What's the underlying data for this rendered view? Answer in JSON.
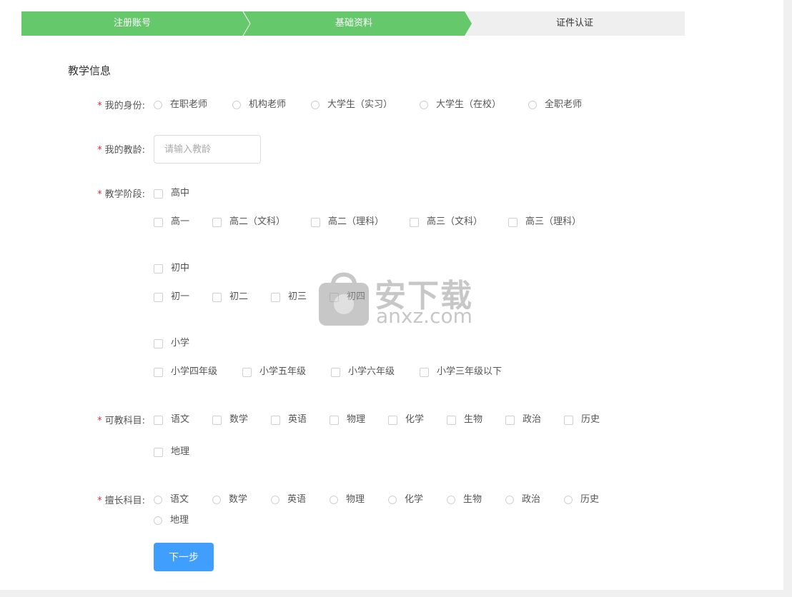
{
  "steps": [
    {
      "label": "注册账号",
      "state": "done"
    },
    {
      "label": "基础资料",
      "state": "done"
    },
    {
      "label": "证件认证",
      "state": "todo"
    }
  ],
  "colors": {
    "step_done": "#65c96b",
    "step_todo": "#efefef",
    "primary": "#409eff",
    "required": "#f5222d"
  },
  "section_title": "教学信息",
  "identity": {
    "label": "我的身份:",
    "options": [
      "在职老师",
      "机构老师",
      "大学生（实习）",
      "大学生（在校）",
      "全职老师"
    ]
  },
  "teaching_age": {
    "label": "我的教龄:",
    "placeholder": "请输入教龄",
    "value": ""
  },
  "stage": {
    "label": "教学阶段:",
    "groups": [
      {
        "name": "高中",
        "grades": [
          "高一",
          "高二（文科）",
          "高二（理科）",
          "高三（文科）",
          "高三（理科）"
        ]
      },
      {
        "name": "初中",
        "grades": [
          "初一",
          "初二",
          "初三",
          "初四"
        ]
      },
      {
        "name": "小学",
        "grades": [
          "小学四年级",
          "小学五年级",
          "小学六年级",
          "小学三年级以下"
        ]
      }
    ]
  },
  "subjects": {
    "label": "可教科目:",
    "options": [
      "语文",
      "数学",
      "英语",
      "物理",
      "化学",
      "生物",
      "政治",
      "历史",
      "地理"
    ]
  },
  "specialty": {
    "label": "擅长科目:",
    "options": [
      "语文",
      "数学",
      "英语",
      "物理",
      "化学",
      "生物",
      "政治",
      "历史",
      "地理"
    ]
  },
  "next_button": "下一步",
  "watermark": {
    "cn": "安下载",
    "en": "anxz.com"
  }
}
